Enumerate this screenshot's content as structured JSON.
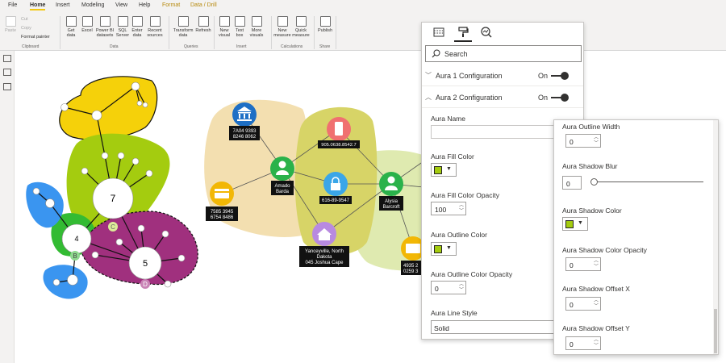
{
  "menu": {
    "file": "File",
    "home": "Home",
    "insert": "Insert",
    "modeling": "Modeling",
    "view": "View",
    "help": "Help",
    "format": "Format",
    "data_drill": "Data / Drill"
  },
  "ribbon": {
    "paste": "Paste",
    "cut": "Cut",
    "copy": "Copy",
    "format_painter": "Format painter",
    "get_data": [
      "Get",
      "data"
    ],
    "excel": "Excel",
    "power_bi_datasets": [
      "Power BI",
      "datasets"
    ],
    "sql_server": [
      "SQL",
      "Server"
    ],
    "enter_data": [
      "Enter",
      "data"
    ],
    "recent_sources": [
      "Recent",
      "sources"
    ],
    "transform_data": [
      "Transform",
      "data"
    ],
    "refresh": "Refresh",
    "new_visual": [
      "New",
      "visual"
    ],
    "text_box": [
      "Text",
      "box"
    ],
    "more_visuals": [
      "More",
      "visuals"
    ],
    "new_measure": [
      "New",
      "measure"
    ],
    "quick_measure": [
      "Quick",
      "measure"
    ],
    "publish": "Publish",
    "groups": {
      "clipboard": "Clipboard",
      "data": "Data",
      "queries": "Queries",
      "insert": "Insert",
      "calculations": "Calculations",
      "share": "Share"
    }
  },
  "graph": {
    "cluster_numbers": {
      "c7": "7",
      "c4": "4",
      "c5": "5"
    },
    "cluster_letters": {
      "c": "C",
      "b": "B",
      "d": "D"
    },
    "nodes": {
      "bank": [
        "7A04 9393",
        "8246 8062"
      ],
      "phone": "905.0638.8542.7",
      "card_left": [
        "7585 3945",
        "6754 8486"
      ],
      "person_amado": [
        "Amado",
        "Barda"
      ],
      "lock": "616-89-9547",
      "person_alysia": [
        "Alysia",
        "Barcroft"
      ],
      "home": [
        "Yanceyville, North",
        "Dakota",
        "045 Joshua Cape"
      ],
      "card_right": [
        "4935 2",
        "0259 3"
      ]
    },
    "colors": {
      "yellow": "#f5d10a",
      "lime": "#a4cc0f",
      "green": "#33bb33",
      "blue": "#3a95f0",
      "purple": "#a0307e",
      "tan": "#f3dfb0",
      "olive": "#d7d467",
      "palegreen": "#dfeab0"
    }
  },
  "pane": {
    "search_placeholder": "Search",
    "aura1": "Aura 1 Configuration",
    "aura1_state": "On",
    "aura2": "Aura 2 Configuration",
    "aura2_state": "On",
    "aura_name": "Aura Name",
    "aura_name_value": "",
    "fill_color": "Aura Fill Color",
    "fill_opacity": "Aura Fill Color Opacity",
    "fill_opacity_value": "100",
    "outline_color": "Aura Outline Color",
    "outline_opacity": "Aura Outline Color Opacity",
    "outline_opacity_value": "0",
    "line_style": "Aura Line Style",
    "line_style_value": "Solid",
    "swatch_color": "#a4cc0f"
  },
  "flyout": {
    "outline_width": "Aura Outline Width",
    "outline_width_value": "0",
    "shadow_blur": "Aura Shadow Blur",
    "shadow_blur_value": "0",
    "shadow_color": "Aura Shadow Color",
    "shadow_opacity": "Aura Shadow Color Opacity",
    "shadow_opacity_value": "0",
    "offset_x": "Aura Shadow Offset X",
    "offset_x_value": "0",
    "offset_y": "Aura Shadow Offset Y",
    "offset_y_value": "0"
  }
}
